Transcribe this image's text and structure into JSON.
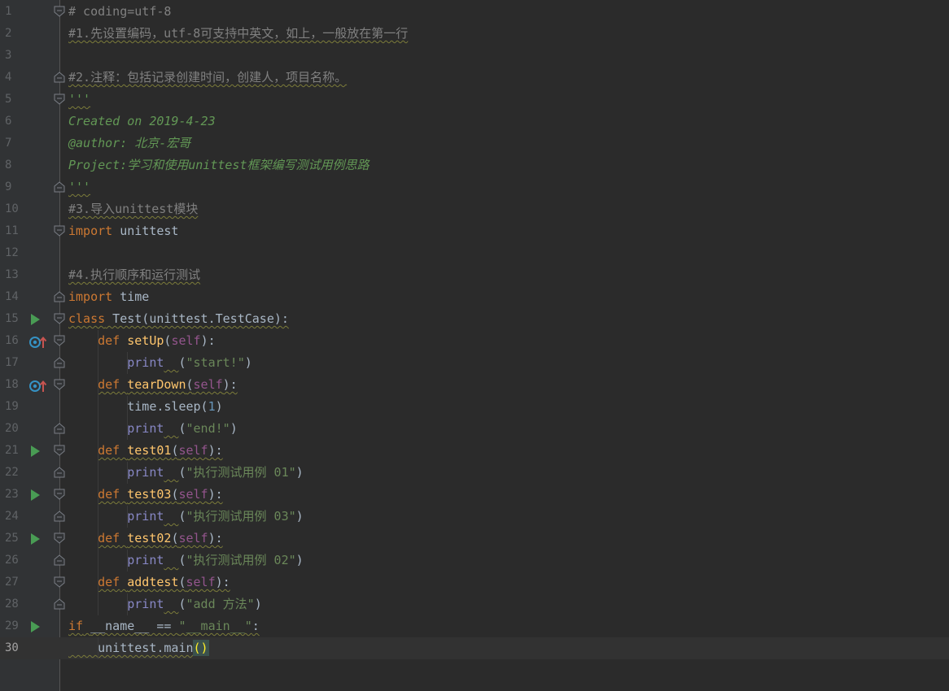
{
  "editor": {
    "colors": {
      "background": "#2b2b2b",
      "gutter": "#313335",
      "keyword": "#cc7832",
      "string": "#6a8759",
      "comment": "#808080",
      "function": "#ffc66d",
      "self": "#94558d"
    },
    "current_line": 30,
    "lines": [
      {
        "n": "1",
        "fold": "open",
        "icon": "",
        "tokens": [
          {
            "t": "# coding=utf-8",
            "c": "cm"
          }
        ]
      },
      {
        "n": "2",
        "fold": "",
        "icon": "",
        "tokens": [
          {
            "t": "#1.先设置编码，utf-8可支持中英文，如上，一般放在第一行",
            "c": "cm wavy"
          }
        ]
      },
      {
        "n": "3",
        "fold": "",
        "icon": "",
        "tokens": []
      },
      {
        "n": "4",
        "fold": "close",
        "icon": "",
        "tokens": [
          {
            "t": "#2.注释：包括记录创建时间，创建人，项目名称。",
            "c": "cm wavy"
          }
        ]
      },
      {
        "n": "5",
        "fold": "open",
        "icon": "",
        "tokens": [
          {
            "t": "'''",
            "c": "doc wavy"
          }
        ]
      },
      {
        "n": "6",
        "fold": "",
        "icon": "",
        "tokens": [
          {
            "t": "Created on 2019-4-23",
            "c": "doc"
          }
        ]
      },
      {
        "n": "7",
        "fold": "",
        "icon": "",
        "tokens": [
          {
            "t": "@author: 北京-宏哥",
            "c": "doc"
          }
        ]
      },
      {
        "n": "8",
        "fold": "",
        "icon": "",
        "tokens": [
          {
            "t": "Project:学习和使用unittest框架编写测试用例思路",
            "c": "doc"
          }
        ]
      },
      {
        "n": "9",
        "fold": "close",
        "icon": "",
        "tokens": [
          {
            "t": "'''",
            "c": "doc wavy"
          }
        ]
      },
      {
        "n": "10",
        "fold": "",
        "icon": "",
        "tokens": [
          {
            "t": "#3.导入unittest模块",
            "c": "cm wavy"
          }
        ]
      },
      {
        "n": "11",
        "fold": "open",
        "icon": "",
        "tokens": [
          {
            "t": "import",
            "c": "kw"
          },
          {
            "t": " unittest",
            "c": "plain"
          }
        ]
      },
      {
        "n": "12",
        "fold": "",
        "icon": "",
        "tokens": []
      },
      {
        "n": "13",
        "fold": "",
        "icon": "",
        "tokens": [
          {
            "t": "#4.执行顺序和运行测试",
            "c": "cm wavy"
          }
        ]
      },
      {
        "n": "14",
        "fold": "close",
        "icon": "",
        "tokens": [
          {
            "t": "import",
            "c": "kw"
          },
          {
            "t": " time",
            "c": "plain"
          }
        ]
      },
      {
        "n": "15",
        "fold": "open",
        "icon": "run",
        "tokens": [
          {
            "t": "class",
            "c": "kw wavy"
          },
          {
            "t": " Test(unittest.TestCase):",
            "c": "plain wavy"
          }
        ]
      },
      {
        "n": "16",
        "fold": "open",
        "icon": "override",
        "tokens": [
          {
            "t": "    "
          },
          {
            "t": "def",
            "c": "kw"
          },
          {
            "t": " ",
            "c": "plain"
          },
          {
            "t": "setUp",
            "c": "fn"
          },
          {
            "t": "(",
            "c": "plain"
          },
          {
            "t": "self",
            "c": "self"
          },
          {
            "t": "):",
            "c": "plain"
          }
        ]
      },
      {
        "n": "17",
        "fold": "close",
        "icon": "",
        "tokens": [
          {
            "t": "        "
          },
          {
            "t": "print",
            "c": "bi"
          },
          {
            "t": "  ",
            "c": "plain wavy"
          },
          {
            "t": "(",
            "c": "plain"
          },
          {
            "t": "\"start!\"",
            "c": "str"
          },
          {
            "t": ")",
            "c": "plain"
          }
        ]
      },
      {
        "n": "18",
        "fold": "open",
        "icon": "override",
        "tokens": [
          {
            "t": "    "
          },
          {
            "t": "def",
            "c": "kw wavy"
          },
          {
            "t": " ",
            "c": "plain wavy"
          },
          {
            "t": "tearDown",
            "c": "fn wavy"
          },
          {
            "t": "(",
            "c": "plain wavy"
          },
          {
            "t": "self",
            "c": "self wavy"
          },
          {
            "t": "):",
            "c": "plain wavy"
          }
        ]
      },
      {
        "n": "19",
        "fold": "",
        "icon": "",
        "tokens": [
          {
            "t": "        "
          },
          {
            "t": "time.sleep(",
            "c": "plain"
          },
          {
            "t": "1",
            "c": "num"
          },
          {
            "t": ")",
            "c": "plain"
          }
        ]
      },
      {
        "n": "20",
        "fold": "close",
        "icon": "",
        "tokens": [
          {
            "t": "        "
          },
          {
            "t": "print",
            "c": "bi"
          },
          {
            "t": "  ",
            "c": "plain wavy"
          },
          {
            "t": "(",
            "c": "plain"
          },
          {
            "t": "\"end!\"",
            "c": "str"
          },
          {
            "t": ")",
            "c": "plain"
          }
        ]
      },
      {
        "n": "21",
        "fold": "open",
        "icon": "run",
        "tokens": [
          {
            "t": "    "
          },
          {
            "t": "def",
            "c": "kw wavy"
          },
          {
            "t": " ",
            "c": "plain wavy"
          },
          {
            "t": "test01",
            "c": "fn wavy"
          },
          {
            "t": "(",
            "c": "plain wavy"
          },
          {
            "t": "self",
            "c": "self wavy"
          },
          {
            "t": "):",
            "c": "plain wavy"
          }
        ]
      },
      {
        "n": "22",
        "fold": "close",
        "icon": "",
        "tokens": [
          {
            "t": "        "
          },
          {
            "t": "print",
            "c": "bi"
          },
          {
            "t": "  ",
            "c": "plain wavy"
          },
          {
            "t": "(",
            "c": "plain"
          },
          {
            "t": "\"执行测试用例 01\"",
            "c": "str"
          },
          {
            "t": ")",
            "c": "plain"
          }
        ]
      },
      {
        "n": "23",
        "fold": "open",
        "icon": "run",
        "tokens": [
          {
            "t": "    "
          },
          {
            "t": "def",
            "c": "kw wavy"
          },
          {
            "t": " ",
            "c": "plain wavy"
          },
          {
            "t": "test03",
            "c": "fn wavy"
          },
          {
            "t": "(",
            "c": "plain wavy"
          },
          {
            "t": "self",
            "c": "self wavy"
          },
          {
            "t": "):",
            "c": "plain wavy"
          }
        ]
      },
      {
        "n": "24",
        "fold": "close",
        "icon": "",
        "tokens": [
          {
            "t": "        "
          },
          {
            "t": "print",
            "c": "bi"
          },
          {
            "t": "  ",
            "c": "plain wavy"
          },
          {
            "t": "(",
            "c": "plain"
          },
          {
            "t": "\"执行测试用例 03\"",
            "c": "str"
          },
          {
            "t": ")",
            "c": "plain"
          }
        ]
      },
      {
        "n": "25",
        "fold": "open",
        "icon": "run",
        "tokens": [
          {
            "t": "    "
          },
          {
            "t": "def",
            "c": "kw wavy"
          },
          {
            "t": " ",
            "c": "plain wavy"
          },
          {
            "t": "test02",
            "c": "fn wavy"
          },
          {
            "t": "(",
            "c": "plain wavy"
          },
          {
            "t": "self",
            "c": "self wavy"
          },
          {
            "t": "):",
            "c": "plain wavy"
          }
        ]
      },
      {
        "n": "26",
        "fold": "close",
        "icon": "",
        "tokens": [
          {
            "t": "        "
          },
          {
            "t": "print",
            "c": "bi"
          },
          {
            "t": "  ",
            "c": "plain wavy"
          },
          {
            "t": "(",
            "c": "plain"
          },
          {
            "t": "\"执行测试用例 02\"",
            "c": "str"
          },
          {
            "t": ")",
            "c": "plain"
          }
        ]
      },
      {
        "n": "27",
        "fold": "open",
        "icon": "",
        "tokens": [
          {
            "t": "    "
          },
          {
            "t": "def",
            "c": "kw wavy"
          },
          {
            "t": " ",
            "c": "plain wavy"
          },
          {
            "t": "addtest",
            "c": "fn wavy"
          },
          {
            "t": "(",
            "c": "plain wavy"
          },
          {
            "t": "self",
            "c": "self wavy"
          },
          {
            "t": "):",
            "c": "plain wavy"
          }
        ]
      },
      {
        "n": "28",
        "fold": "close",
        "icon": "",
        "tokens": [
          {
            "t": "        "
          },
          {
            "t": "print",
            "c": "bi"
          },
          {
            "t": "  ",
            "c": "plain wavy"
          },
          {
            "t": "(",
            "c": "plain"
          },
          {
            "t": "\"add 方法\"",
            "c": "str"
          },
          {
            "t": ")",
            "c": "plain"
          }
        ]
      },
      {
        "n": "29",
        "fold": "",
        "icon": "run",
        "tokens": [
          {
            "t": "if",
            "c": "kw wavy"
          },
          {
            "t": " ",
            "c": "plain wavy"
          },
          {
            "t": "__name__",
            "c": "plain wavy"
          },
          {
            "t": " == ",
            "c": "plain wavy"
          },
          {
            "t": "\"__main__\"",
            "c": "str wavy"
          },
          {
            "t": ":",
            "c": "plain wavy"
          }
        ]
      },
      {
        "n": "30",
        "fold": "",
        "icon": "",
        "tokens": [
          {
            "t": "    ",
            "c": "wavy"
          },
          {
            "t": "unittest.main",
            "c": "plain wavy"
          },
          {
            "t": "()",
            "c": "brace-hl"
          }
        ]
      }
    ]
  }
}
